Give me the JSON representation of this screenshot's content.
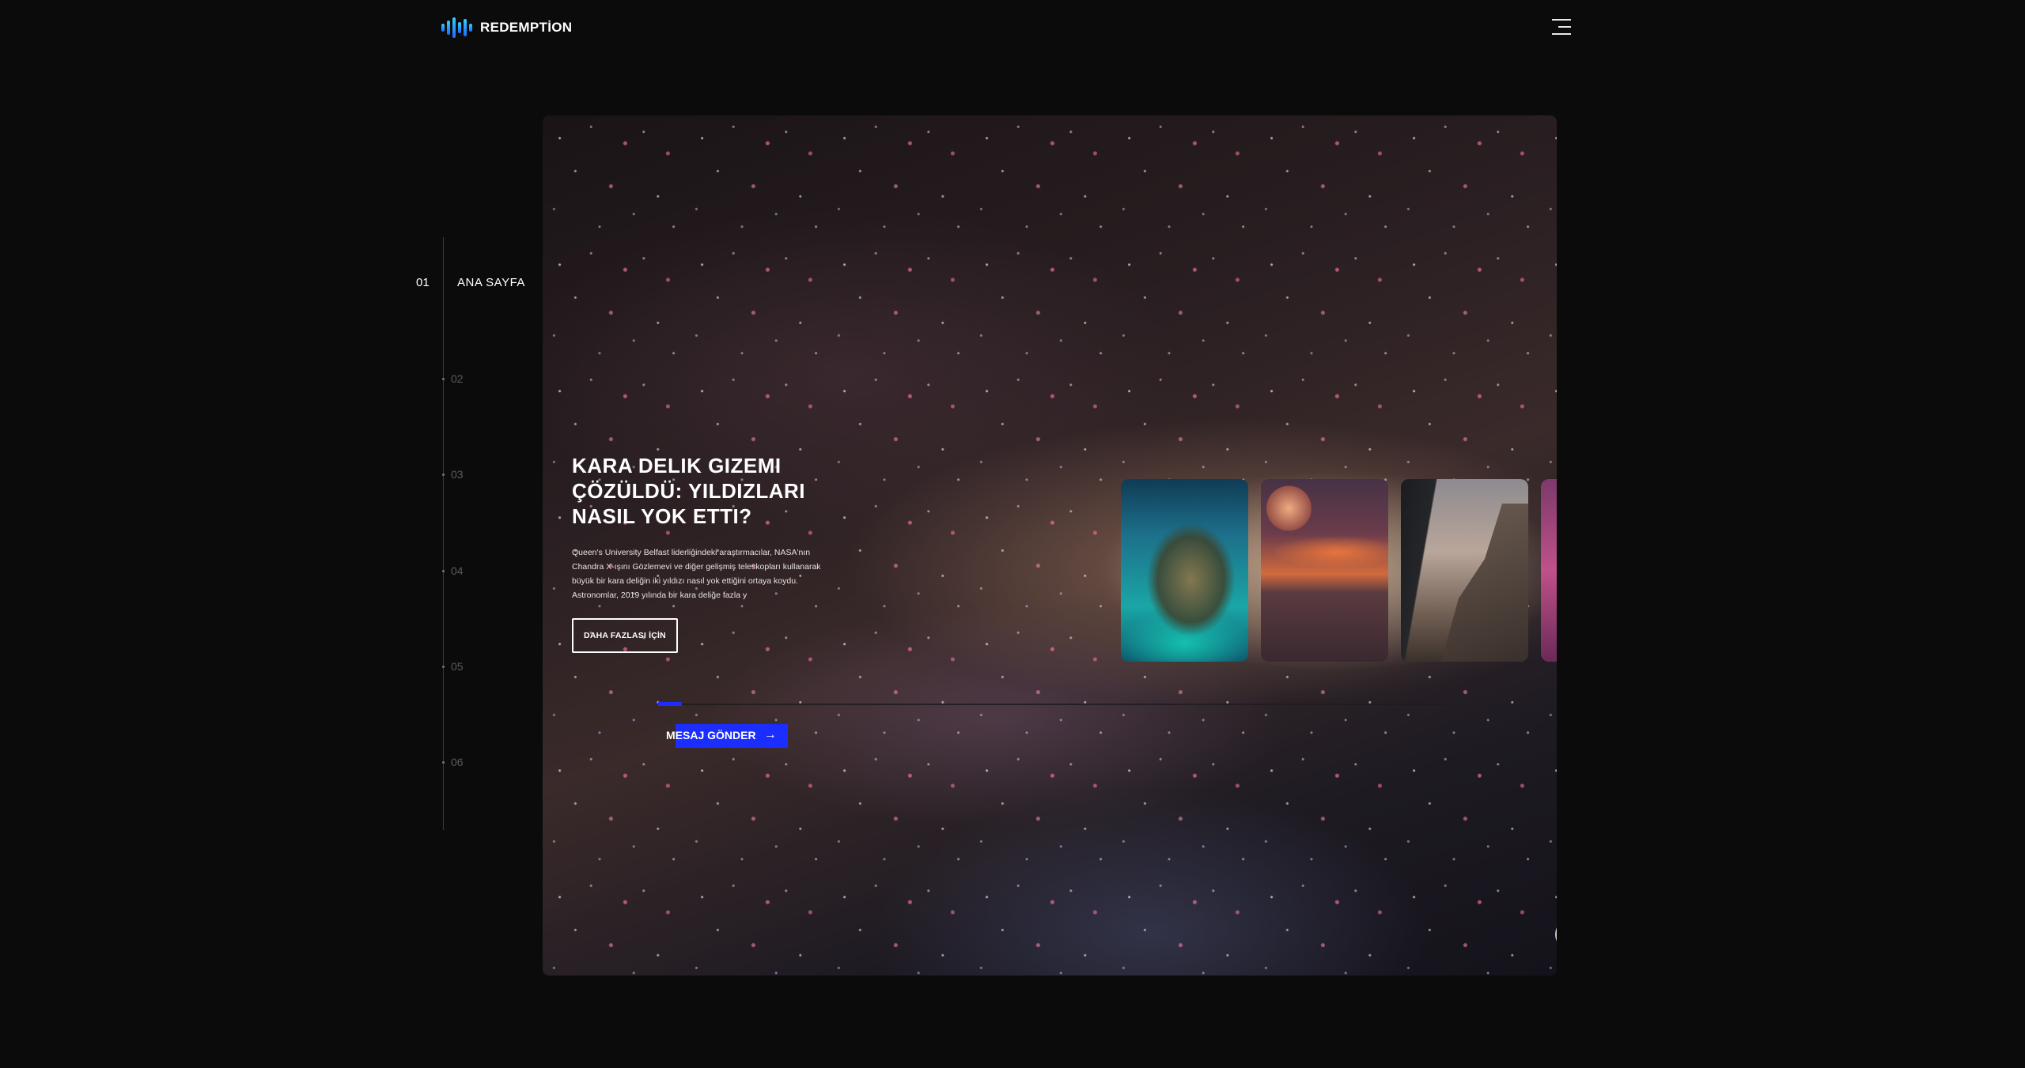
{
  "brand": {
    "name": "REDEMPTİON"
  },
  "header": {
    "menu_icon": "hamburger-icon"
  },
  "side_nav": {
    "active_number": "01",
    "active_label": "ANA SAYFA",
    "items": [
      "01",
      "02",
      "03",
      "04",
      "05",
      "06"
    ]
  },
  "hero": {
    "title": "KARA DELIK GIZEMI\nÇÖZÜLDÜ: YILDIZLARI\nNASIL YOK ETTI?",
    "body": "Queen's University Belfast liderliğindeki araştırmacılar, NASA'nın Chandra X-ışını Gözlemevi ve diğer gelişmiş teleskopları kullanarak büyük bir kara deliğin iki yıldızı nasıl yok ettiğini ortaya koydu. Astronomlar, 2019 yılında bir kara deliğe fazla y",
    "more_button": "DAHA FAZLASI İÇİN",
    "send_button": "MESAJ GÖNDER",
    "send_icon": "arrow-right-icon",
    "progress": 0.03
  },
  "slider": {
    "prev_icon": "arrow-left-icon",
    "next_icon": "arrow-right-icon"
  },
  "colors": {
    "background": "#0b0b0c",
    "accent": "#1b2dff",
    "logo_gradient": [
      "#2fd1ff",
      "#1f6bff"
    ]
  }
}
